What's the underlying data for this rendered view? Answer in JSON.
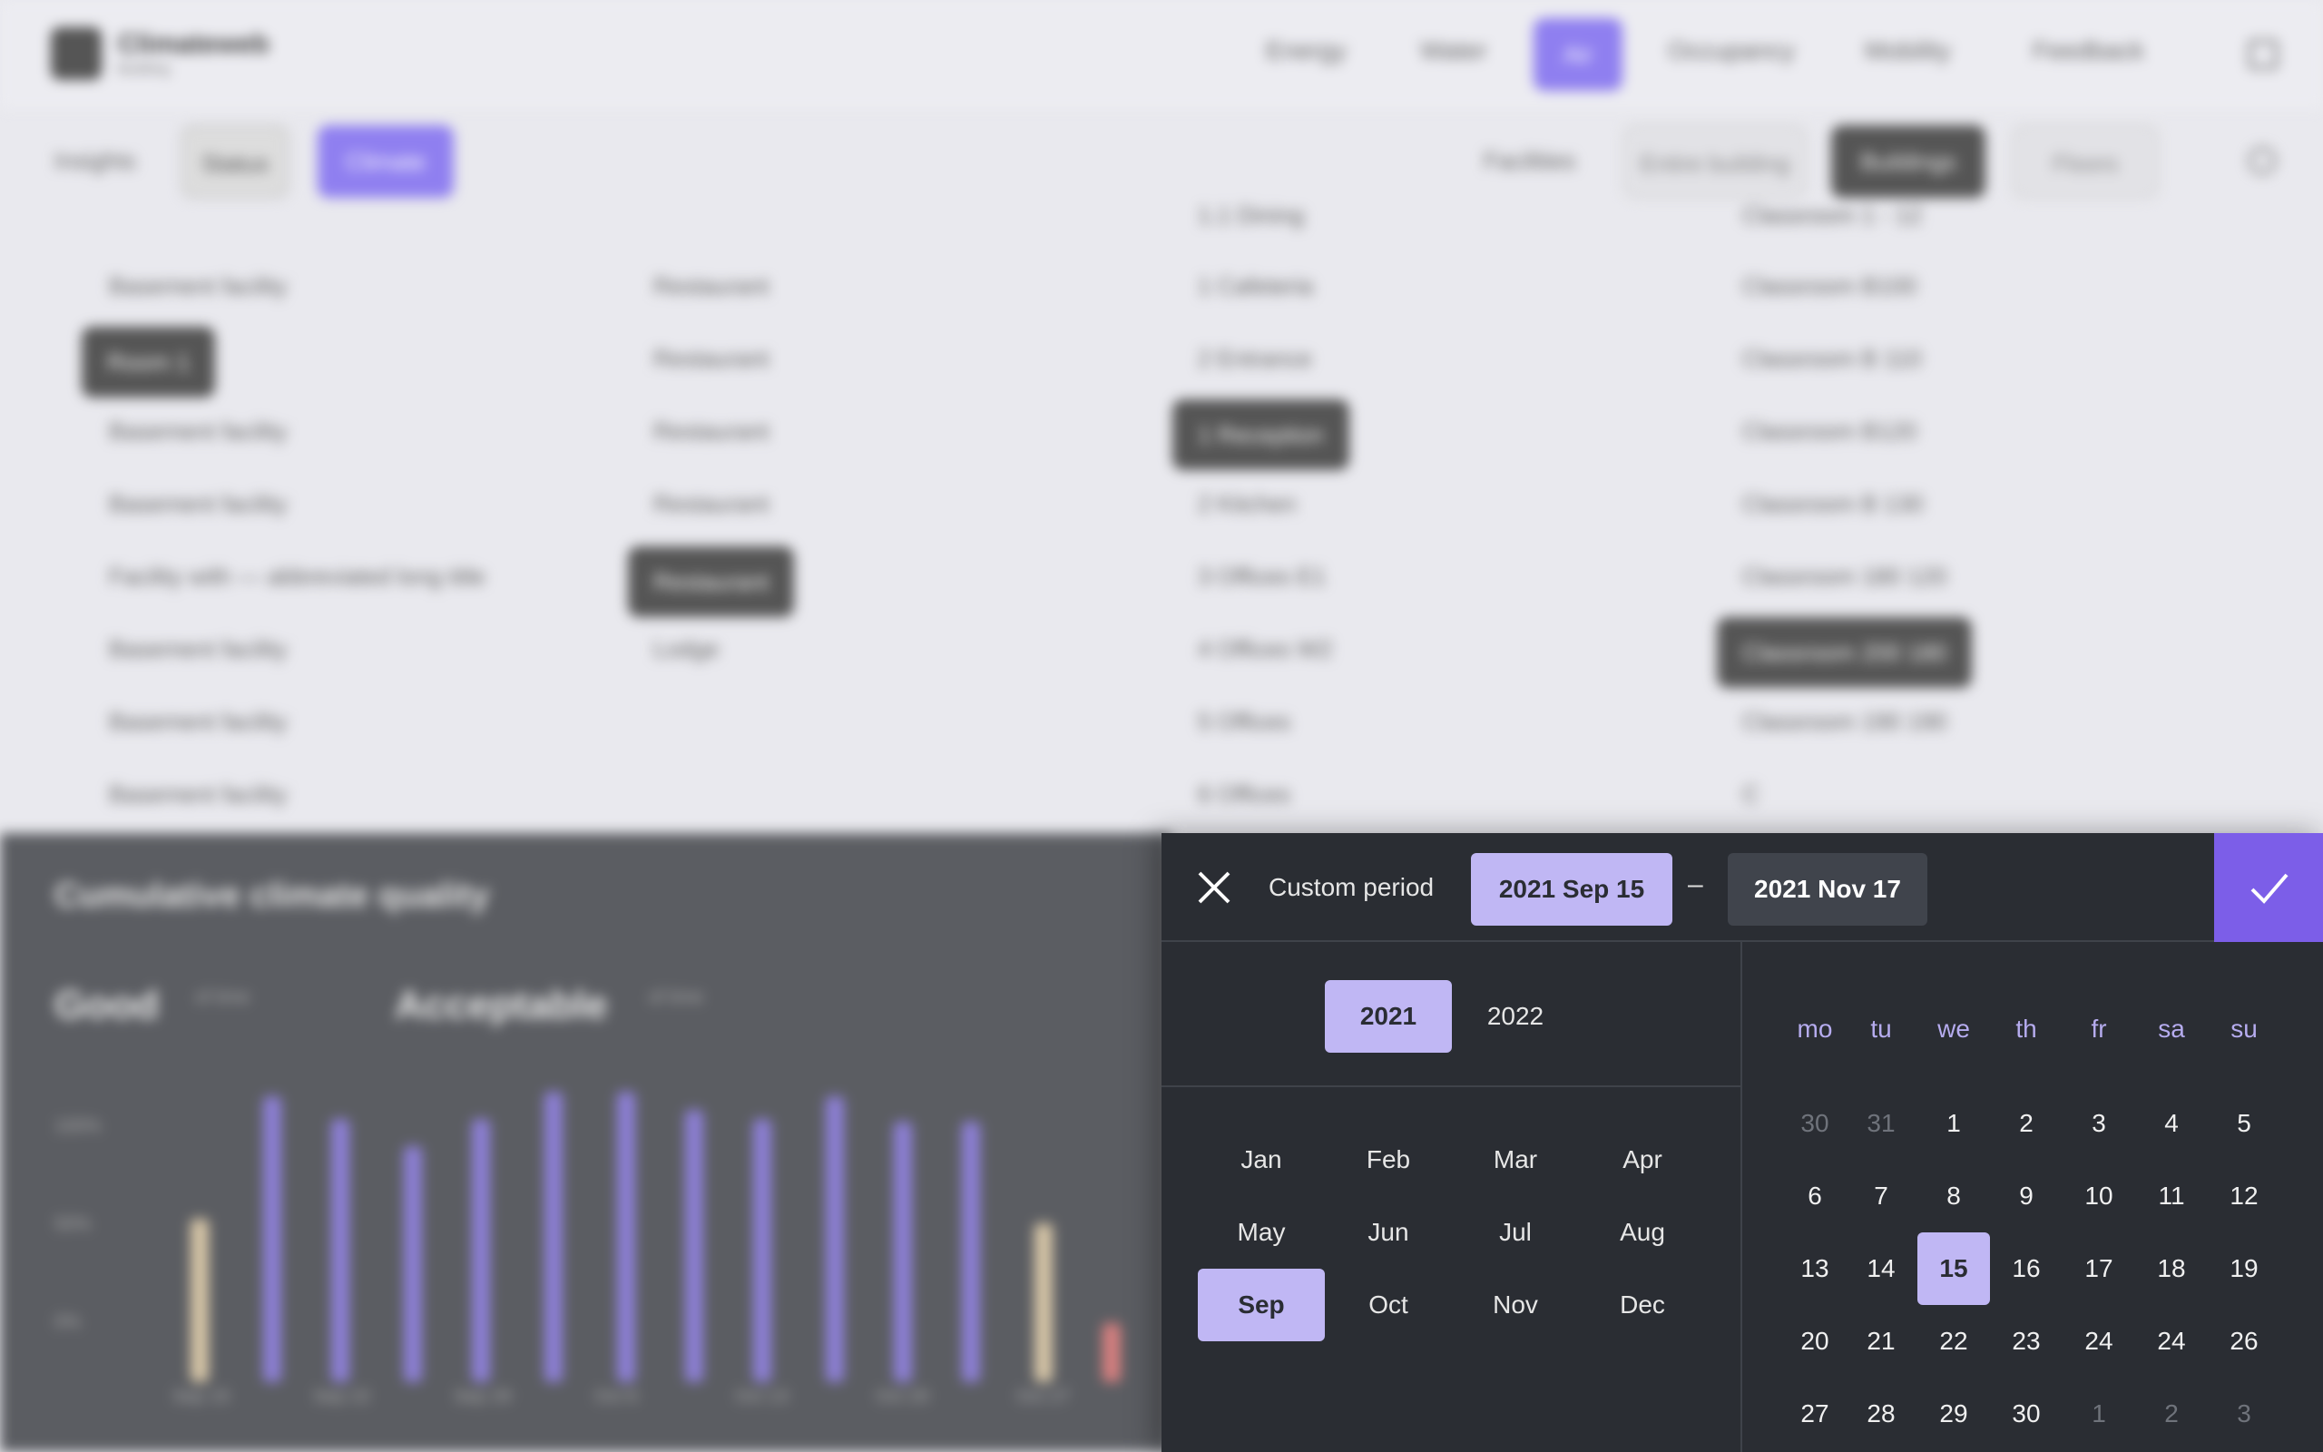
{
  "background": {
    "logo": {
      "title": "Climateweb",
      "subtitle": "Building"
    },
    "nav": [
      "Energy",
      "Water",
      "Air",
      "Occupancy",
      "Mobility",
      "Feedback"
    ],
    "nav_active": "Air",
    "filters": {
      "label": "Insights",
      "chips": [
        "Status",
        "Climate"
      ],
      "right_label": "Facilities",
      "right_chips": [
        "Entire building",
        "Buildings",
        "Floors"
      ]
    },
    "lists": {
      "col1": [
        "Basement facility",
        "Room 1",
        "Basement facility",
        "Basement facility",
        "Facility with — abbreviated long title",
        "Basement facility",
        "Basement facility",
        "Basement facility"
      ],
      "col2": [
        "Restaurant",
        "Restaurant",
        "Restaurant",
        "Restaurant",
        "Restaurant",
        "Lodge"
      ],
      "col3": [
        "1.1 Dining",
        "1 Cafeteria",
        "2 Entrance",
        "1 Reception",
        "2 Kitchen",
        "3 Offices E1",
        "4 Offices W2",
        "5 Offices",
        "6 Offices"
      ],
      "col4": [
        "Classroom 1 - 12",
        "Classroom B100",
        "Classroom B 110",
        "Classroom B120",
        "Classroom B 130",
        "Classroom 180 120",
        "Classroom 200 180",
        "Classroom 190 190",
        "C"
      ]
    },
    "panel": {
      "title": "Cumulative climate quality",
      "good_label": "Good",
      "good_sub": "of time",
      "acceptable_label": "Acceptable",
      "acceptable_sub": "of time",
      "yticks": [
        "100%",
        "50%",
        "0%"
      ],
      "xticks": [
        "Sep 15",
        "Sep 22",
        "Sep 29",
        "Oct 6",
        "Oct 13",
        "Oct 20",
        "Oct 27"
      ]
    }
  },
  "picker": {
    "close_icon": "close-icon",
    "title": "Custom period",
    "start": "2021 Sep 15",
    "separator": "–",
    "end": "2021 Nov 17",
    "confirm_icon": "check-icon",
    "years": [
      "2021",
      "2022"
    ],
    "selected_year": "2021",
    "months": [
      "Jan",
      "Feb",
      "Mar",
      "Apr",
      "May",
      "Jun",
      "Jul",
      "Aug",
      "Sep",
      "Oct",
      "Nov",
      "Dec"
    ],
    "selected_month": "Sep",
    "weekdays": [
      "mo",
      "tu",
      "we",
      "th",
      "fr",
      "sa",
      "su"
    ],
    "weeks": [
      [
        "30",
        "31",
        "1",
        "2",
        "3",
        "4",
        "5"
      ],
      [
        "6",
        "7",
        "8",
        "9",
        "10",
        "11",
        "12"
      ],
      [
        "13",
        "14",
        "15",
        "16",
        "17",
        "18",
        "19"
      ],
      [
        "20",
        "21",
        "22",
        "23",
        "24",
        "24",
        "26"
      ],
      [
        "27",
        "28",
        "29",
        "30",
        "1",
        "2",
        "3"
      ]
    ],
    "muted_days": [
      [
        0,
        0
      ],
      [
        0,
        1
      ],
      [
        4,
        4
      ],
      [
        4,
        5
      ],
      [
        4,
        6
      ]
    ],
    "selected_day": [
      2,
      2
    ],
    "colors": {
      "accent": "#7c5ee8",
      "selection": "#c0b7f4",
      "panel": "#2a2d33"
    }
  }
}
